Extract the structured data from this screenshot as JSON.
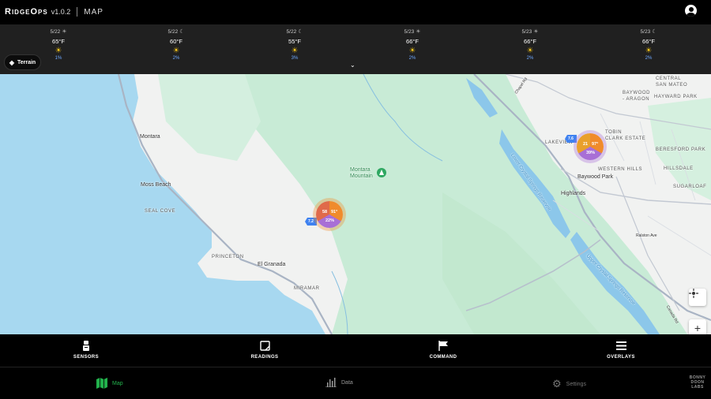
{
  "app": {
    "name": "RidgeOps",
    "version": "v1.0.2",
    "page": "MAP"
  },
  "colors": {
    "accent_green": "#22b14c",
    "cluster_orange": "#f08b2c",
    "cluster_purple": "#a86fd6",
    "flag_blue": "#3f82f0"
  },
  "weather": [
    {
      "date": "5/22",
      "sym": "☀",
      "temp": "65°F",
      "icon": "sun-icon",
      "pct": "1%"
    },
    {
      "date": "5/22",
      "sym": "☾",
      "temp": "60°F",
      "icon": "sun-icon",
      "pct": "2%"
    },
    {
      "date": "5/22",
      "sym": "☾",
      "temp": "55°F",
      "icon": "sun-icon",
      "pct": "3%"
    },
    {
      "date": "5/23",
      "sym": "☀",
      "temp": "66°F",
      "icon": "sun-icon",
      "pct": "2%"
    },
    {
      "date": "5/23",
      "sym": "☀",
      "temp": "66°F",
      "icon": "sun-icon",
      "pct": "2%"
    },
    {
      "date": "5/23",
      "sym": "☾",
      "temp": "66°F",
      "icon": "sun-icon",
      "pct": "2%"
    }
  ],
  "terrain_label": "Terrain",
  "map": {
    "labels": {
      "montara": "Montara",
      "moss_beach": "Moss Beach",
      "seal_cove": "SEAL COVE",
      "princeton": "PRINCETON",
      "el_granada": "El Granada",
      "miramar": "MIRAMAR",
      "montara_mountain": "Montara\nMountain",
      "highlands": "Highlands",
      "baywood_park": "Baywood Park",
      "western_hills": "WESTERN HILLS",
      "lakeview": "LAKEVIEW",
      "tobin_clark": "TOBIN\nCLARK ESTATE",
      "beresford": "BERESFORD PARK",
      "hillsdale": "HILLSDALE",
      "sugarloaf": "SUGARLOAF",
      "baywood_aragon": "BAYWOOD\n- ARAGON",
      "hayward_park": "HAYWARD PARK",
      "central_san_mateo": "CENTRAL\nSAN MATEO",
      "lower_crystal": "Lower Crystal Springs Reservoir",
      "upper_crystal": "Upper Crystal Springs Reservoir",
      "ralston_ave": "Ralston Ave",
      "canada_rd": "Canada Rd",
      "chapel_rd": "Chapel Rd"
    },
    "clusters": [
      {
        "id": "cluster-1",
        "a": "58",
        "b": "91°",
        "c": "22%",
        "flag": "7.2"
      },
      {
        "id": "cluster-2",
        "a": "21",
        "b": "97°",
        "c": "39%",
        "flag": "7.6"
      }
    ]
  },
  "toolbar": [
    {
      "label": "SENSORS",
      "icon": "sensor-icon"
    },
    {
      "label": "READINGS",
      "icon": "readings-icon"
    },
    {
      "label": "COMMAND",
      "icon": "flag-icon"
    },
    {
      "label": "OVERLAYS",
      "icon": "menu-icon"
    }
  ],
  "nav": {
    "map": "Map",
    "data": "Data",
    "settings": "Settings"
  },
  "logo": "BONNY\nDOON\nLABS"
}
